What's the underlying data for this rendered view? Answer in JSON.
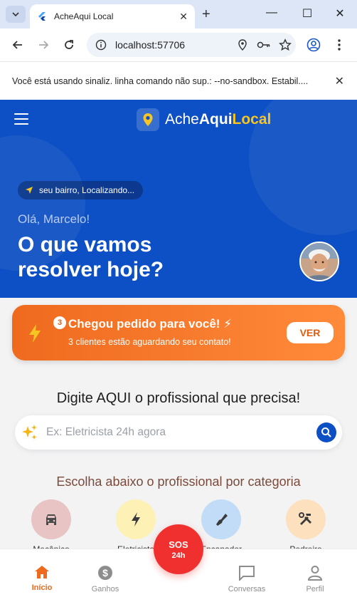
{
  "browser": {
    "tab_title": "AcheAqui Local",
    "url": "localhost:57706",
    "infobar": "Você está usando sinaliz. linha comando não sup.: --no-sandbox. Estabil...."
  },
  "app": {
    "logo": {
      "part1": "Ache",
      "part2": "Aqui",
      "part3": "Local"
    },
    "location": "seu bairro, Localizando...",
    "greeting": "Olá, Marcelo!",
    "headline": "O que vamos resolver hoje?",
    "alert": {
      "badge": "3",
      "title": "Chegou pedido para você! ⚡",
      "subtitle": "3 clientes estão aguardando seu contato!",
      "button": "VER"
    },
    "search_title": "Digite AQUI o profissional que precisa!",
    "search_placeholder": "Ex: Eletricista 24h agora",
    "category_title": "Escolha abaixo o profissional por categoria",
    "categories": [
      {
        "label": "Mecânico",
        "color": "#e8c4c4"
      },
      {
        "label": "Eletricista",
        "color": "#fdf1b6"
      },
      {
        "label": "Encanador",
        "color": "#c2dcf7"
      },
      {
        "label": "Pedreiro",
        "color": "#fde0bd"
      }
    ],
    "nav": {
      "home": "Início",
      "earnings": "Ganhos",
      "sos_line1": "SOS",
      "sos_line2": "24h",
      "chats": "Conversas",
      "profile": "Perfil"
    },
    "colors": {
      "primary": "#0d4fc4",
      "accent": "#ef6a1e",
      "sos": "#f0302e",
      "highlight": "#f5c523"
    }
  }
}
